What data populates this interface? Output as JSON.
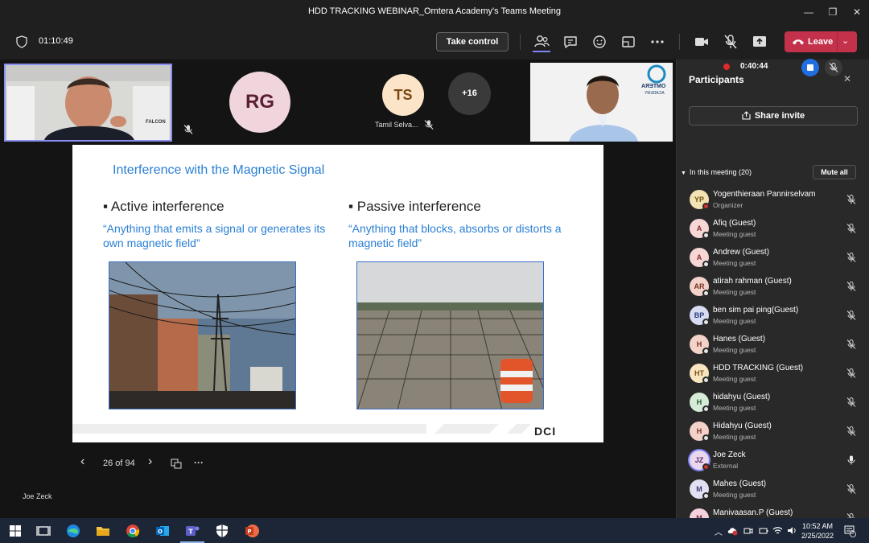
{
  "window": {
    "title": "HDD TRACKING WEBINAR_Omtera Academy's Teams Meeting",
    "minimize": "—",
    "maximize": "❐",
    "close": "✕"
  },
  "toolbar": {
    "elapsed": "01:10:49",
    "take_control": "Take control",
    "leave": "Leave",
    "leave_chevron": "⌄"
  },
  "stage": {
    "tiles": [
      {
        "initials": "RG",
        "bg": "#f1d5dd",
        "fg": "#5b1f33"
      },
      {
        "initials": "TS",
        "bg": "#fbe4c7",
        "fg": "#7a4a14",
        "name": "Tamil Selva..."
      }
    ],
    "overflow": "+16",
    "right_tile_logo_line1": "OMTERA",
    "right_tile_logo_line2": "ACADEMY",
    "self_tile_mug_text": "FALCON",
    "presenter_name": "Joe Zeck"
  },
  "slide": {
    "title": "Interference with the Magnetic Signal",
    "left": {
      "bullet": "Active interference",
      "quote": "“Anything that emits a signal or generates its own magnetic field”"
    },
    "right": {
      "bullet": "Passive interference",
      "quote": "“Anything that blocks, absorbs or distorts a magnetic field”"
    },
    "logo": "DCI",
    "nav": {
      "page": "26 of 94",
      "prev": "‹",
      "next": "›",
      "more": "···"
    }
  },
  "recording": {
    "time": "0:40:44"
  },
  "panel": {
    "title": "Participants",
    "share_invite": "Share invite",
    "in_meeting": "In this meeting (20)",
    "mute_all": "Mute all",
    "participants": [
      {
        "initials": "YP",
        "name": "Yogenthieraan Pannirselvam",
        "role": "Organizer",
        "bg": "#f3e3b4",
        "fg": "#6b5212",
        "status": "red",
        "mic": "off"
      },
      {
        "initials": "A",
        "name": "Afiq (Guest)",
        "role": "Meeting guest",
        "bg": "#f7d6d6",
        "fg": "#8a2a2a",
        "status": "grey",
        "mic": "off"
      },
      {
        "initials": "A",
        "name": "Andrew (Guest)",
        "role": "Meeting guest",
        "bg": "#f7d6d6",
        "fg": "#8a2a2a",
        "status": "grey",
        "mic": "off"
      },
      {
        "initials": "AR",
        "name": "atirah rahman (Guest)",
        "role": "Meeting guest",
        "bg": "#f3d2c9",
        "fg": "#7a3020",
        "status": "grey",
        "mic": "off"
      },
      {
        "initials": "BP",
        "name": "ben sim pai ping(Guest)",
        "role": "Meeting guest",
        "bg": "#d7dcf3",
        "fg": "#2b3a7a",
        "status": "grey",
        "mic": "off"
      },
      {
        "initials": "H",
        "name": "Hanes (Guest)",
        "role": "Meeting guest",
        "bg": "#f3d2c9",
        "fg": "#7a3020",
        "status": "grey",
        "mic": "off"
      },
      {
        "initials": "HT",
        "name": "HDD TRACKING (Guest)",
        "role": "Meeting guest",
        "bg": "#f8e5c0",
        "fg": "#7a5212",
        "status": "grey",
        "mic": "off"
      },
      {
        "initials": "H",
        "name": "hidahyu (Guest)",
        "role": "Meeting guest",
        "bg": "#d6ecd8",
        "fg": "#245a2e",
        "status": "grey",
        "mic": "off"
      },
      {
        "initials": "H",
        "name": "Hidahyu (Guest)",
        "role": "Meeting guest",
        "bg": "#f3d2c9",
        "fg": "#7a3020",
        "status": "grey",
        "mic": "off"
      },
      {
        "initials": "JZ",
        "name": "Joe Zeck",
        "role": "External",
        "bg": "#e9d7ee",
        "fg": "#5a2a6a",
        "status": "red",
        "mic": "on"
      },
      {
        "initials": "M",
        "name": "Mahes (Guest)",
        "role": "Meeting guest",
        "bg": "#e2e0f3",
        "fg": "#3a3a7a",
        "status": "grey",
        "mic": "off"
      },
      {
        "initials": "M",
        "name": "Manivaasan.P (Guest)",
        "role": "Meeting guest",
        "bg": "#f3d2dc",
        "fg": "#7a2a40",
        "status": "grey",
        "mic": "off"
      }
    ]
  },
  "taskbar": {
    "time": "10:52 AM",
    "date": "2/25/2022",
    "notif_count": "6",
    "lang": "ENG"
  }
}
